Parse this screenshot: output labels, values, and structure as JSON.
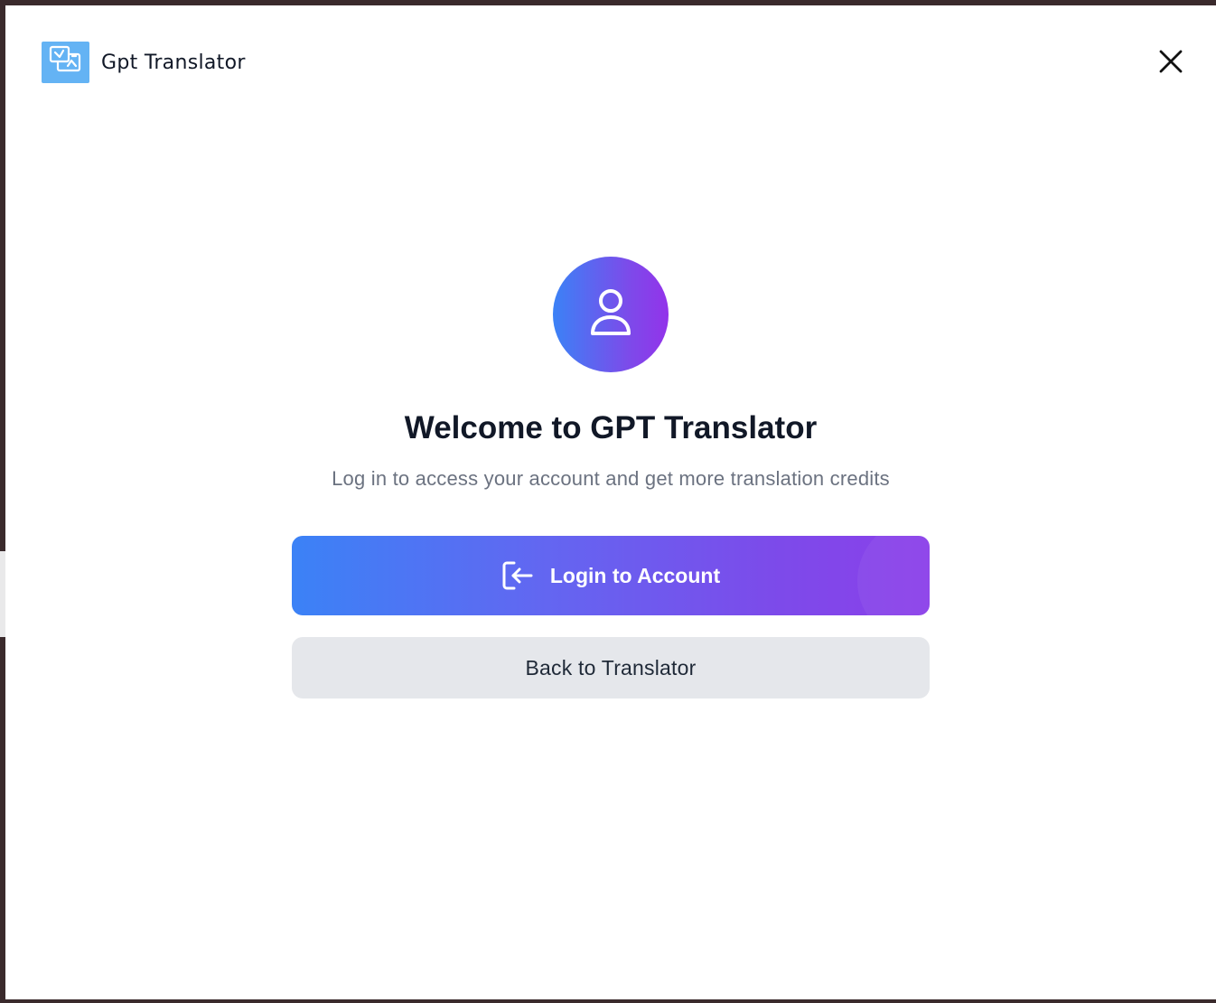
{
  "header": {
    "app_title": "Gpt Translator",
    "logo_icon": "translate-swap-icon",
    "close_icon": "close-icon"
  },
  "main": {
    "avatar_icon": "user-icon",
    "welcome_title": "Welcome to GPT Translator",
    "subtitle": "Log in to access your account and get more translation credits",
    "login_button_label": "Login to Account",
    "login_button_icon": "login-arrow-icon",
    "back_button_label": "Back to Translator"
  },
  "colors": {
    "gradient_start": "#3b82f6",
    "gradient_end": "#9333ea",
    "logo_bg": "#64b3f4",
    "secondary_button_bg": "#e5e7eb",
    "subtitle_text": "#6b7280",
    "title_text": "#111827"
  }
}
